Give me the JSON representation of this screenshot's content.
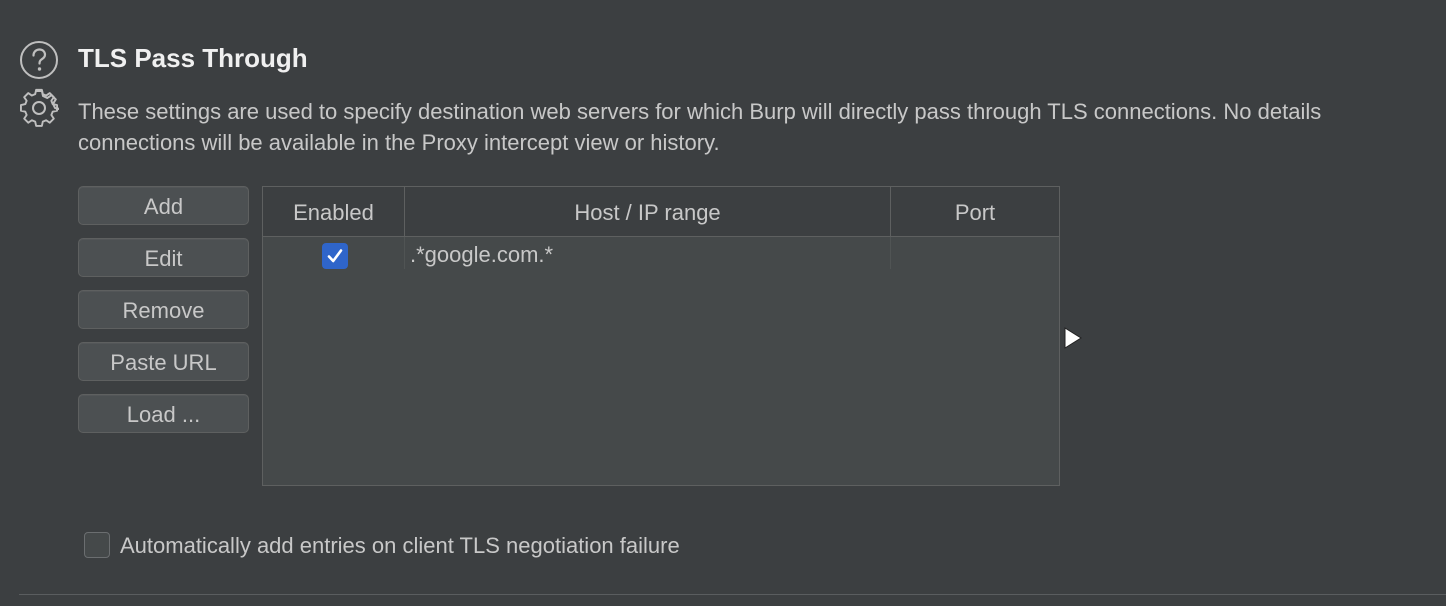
{
  "section": {
    "title": "TLS Pass Through",
    "description_lines": [
      "These settings are used to specify destination web servers for which Burp will directly pass through TLS connections. No details",
      "connections will be available in the Proxy intercept view or history."
    ],
    "help_icon": "help-circle-icon",
    "settings_icon": "gear-icon"
  },
  "buttons": {
    "add": "Add",
    "edit": "Edit",
    "remove": "Remove",
    "paste_url": "Paste URL",
    "load": "Load ..."
  },
  "table": {
    "columns": [
      "Enabled",
      "Host / IP range",
      "Port"
    ],
    "rows": [
      {
        "enabled": true,
        "host": ".*google.com.*",
        "port": ""
      }
    ]
  },
  "auto_add": {
    "label": "Automatically add entries on client TLS negotiation failure",
    "checked": false
  },
  "colors": {
    "background": "#3c3f41",
    "accent_checkbox": "#2f65ca"
  }
}
